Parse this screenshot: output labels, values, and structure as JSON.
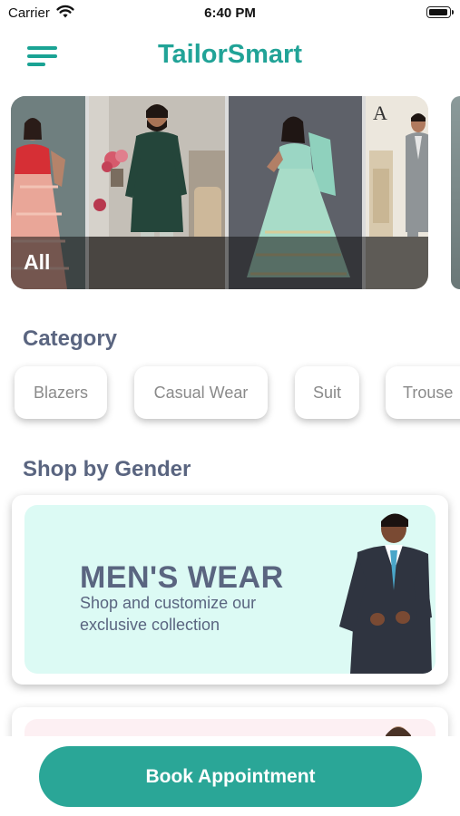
{
  "status_bar": {
    "carrier": "Carrier",
    "time": "6:40 PM",
    "icons": [
      "wifi-icon",
      "battery-icon"
    ]
  },
  "header": {
    "title": "TailorSmart",
    "menu_icon": "hamburger-menu-icon"
  },
  "banner": {
    "label": "All",
    "panels": [
      "woman-lehenga-red",
      "man-green-kurta",
      "woman-mint-lehenga",
      "man-grey-suit"
    ]
  },
  "category": {
    "title": "Category",
    "items": [
      "Blazers",
      "Casual Wear",
      "Suit",
      "Trouse"
    ]
  },
  "gender": {
    "title": "Shop by Gender",
    "mens": {
      "title": "MEN'S WEAR",
      "subtitle": "Shop and customize our exclusive collection"
    }
  },
  "cta": {
    "label": "Book Appointment"
  },
  "colors": {
    "brand": "#21a397",
    "button": "#2aa697",
    "heading": "#5a6580",
    "mens_bg": "#dcfaf4",
    "womens_bg": "#fdf0f3"
  }
}
